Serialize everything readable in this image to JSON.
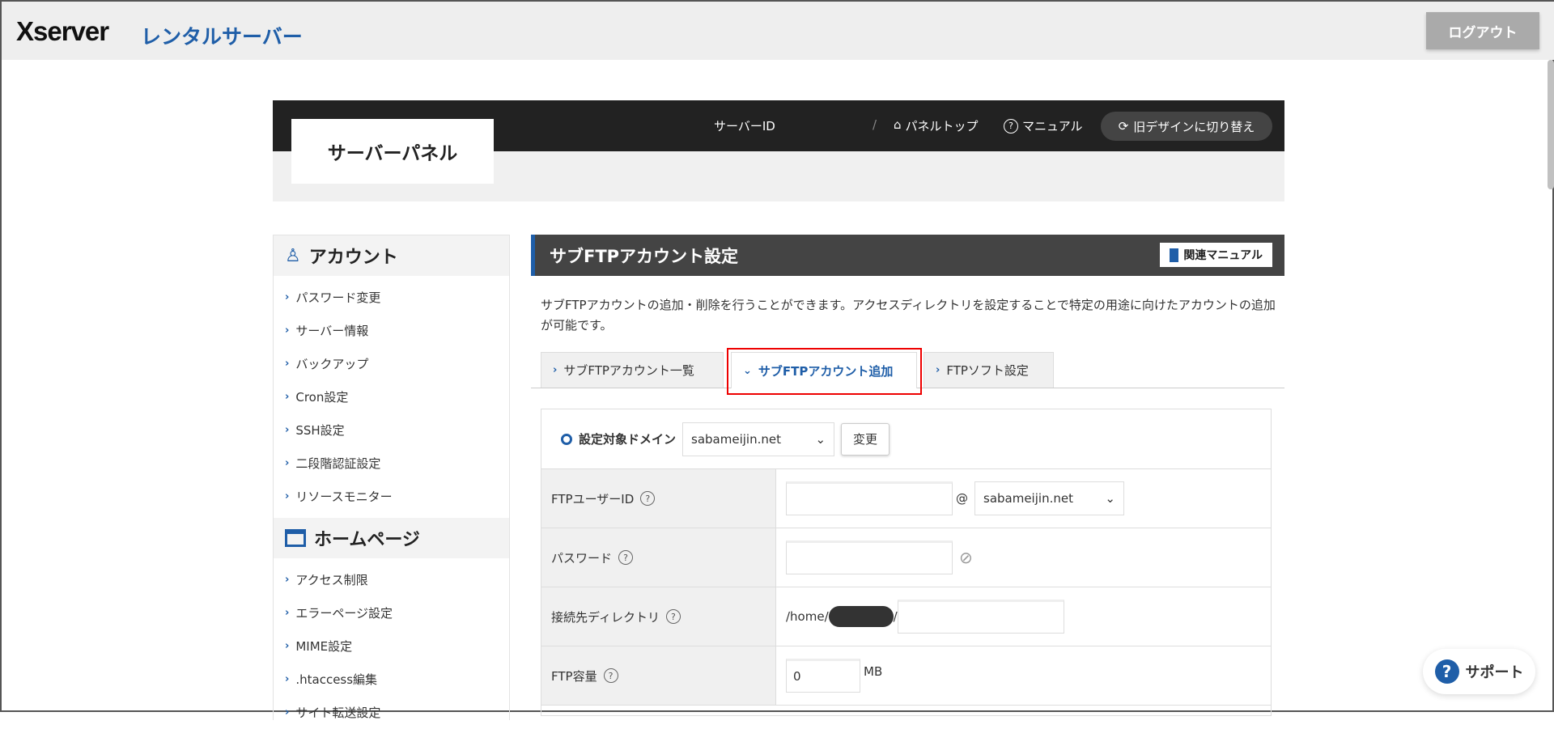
{
  "header": {
    "logo": "Xserver",
    "logo_sub": "レンタルサーバー",
    "logout": "ログアウト"
  },
  "panel": {
    "title": "サーバーパネル",
    "server_id": "サーバーID",
    "panel_top": "パネルトップ",
    "manual": "マニュアル",
    "old_design": "旧デザインに切り替え"
  },
  "sidebar": {
    "sections": [
      {
        "title": "アカウント",
        "items": [
          "パスワード変更",
          "サーバー情報",
          "バックアップ",
          "Cron設定",
          "SSH設定",
          "二段階認証設定",
          "リソースモニター"
        ]
      },
      {
        "title": "ホームページ",
        "items": [
          "アクセス制限",
          "エラーページ設定",
          "MIME設定",
          ".htaccess編集",
          "サイト転送設定"
        ]
      }
    ]
  },
  "main": {
    "title": "サブFTPアカウント設定",
    "related_manual": "関連マニュアル",
    "description": "サブFTPアカウントの追加・削除を行うことができます。アクセスディレクトリを設定することで特定の用途に向けたアカウントの追加が可能です。",
    "tabs": [
      "サブFTPアカウント一覧",
      "サブFTPアカウント追加",
      "FTPソフト設定"
    ],
    "domain_label": "設定対象ドメイン",
    "domain_value": "sabameijin.net",
    "change_button": "変更",
    "rows": [
      {
        "label": "FTPユーザーID",
        "value": "",
        "at": "@",
        "domain": "sabameijin.net"
      },
      {
        "label": "パスワード",
        "value": ""
      },
      {
        "label": "接続先ディレクトリ",
        "prefix": "/home/",
        "suffix": "/",
        "value": ""
      },
      {
        "label": "FTP容量",
        "value": "0",
        "unit": "MB"
      }
    ]
  },
  "help_glyph": "?",
  "support": "サポート",
  "colors": {
    "accent": "#1f5ea8",
    "highlight": "#ee0000"
  }
}
